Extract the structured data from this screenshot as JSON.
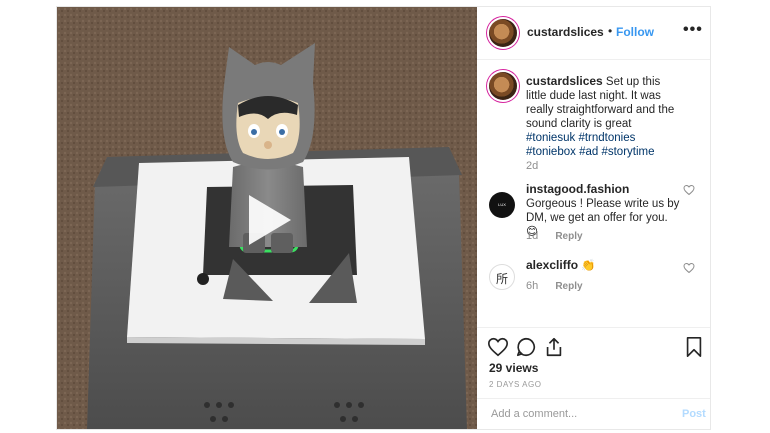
{
  "header": {
    "username": "custardslices",
    "separator": "•",
    "follow_label": "Follow",
    "more_label": "•••"
  },
  "caption": {
    "username": "custardslices",
    "text": "Set up this little dude last night. It was really straightforward and the sound clarity is great",
    "hashtags": [
      "#toniesuk",
      "#trndtonies",
      "#toniebox",
      "#ad",
      "#storytime"
    ],
    "time": "2d"
  },
  "comments": [
    {
      "username": "instagood.fashion",
      "text": "Gorgeous ! Please write us by DM, we get an offer for you. 😊",
      "time": "1d",
      "reply_label": "Reply",
      "avatar_text": "LUX WAHNITE"
    },
    {
      "username": "alexcliffo",
      "text": "👏",
      "time": "6h",
      "reply_label": "Reply",
      "avatar_text": "所"
    }
  ],
  "actions": {
    "views": "29 views",
    "date": "2 DAYS AGO",
    "icons": [
      "heart-icon",
      "comment-icon",
      "share-icon",
      "bookmark-icon"
    ]
  },
  "add_comment": {
    "placeholder": "Add a comment...",
    "post_label": "Post"
  },
  "colors": {
    "link_blue": "#3897f0",
    "hashtag": "#003569",
    "post_disabled": "#b3dbff",
    "story_ring": "#d6249f"
  }
}
